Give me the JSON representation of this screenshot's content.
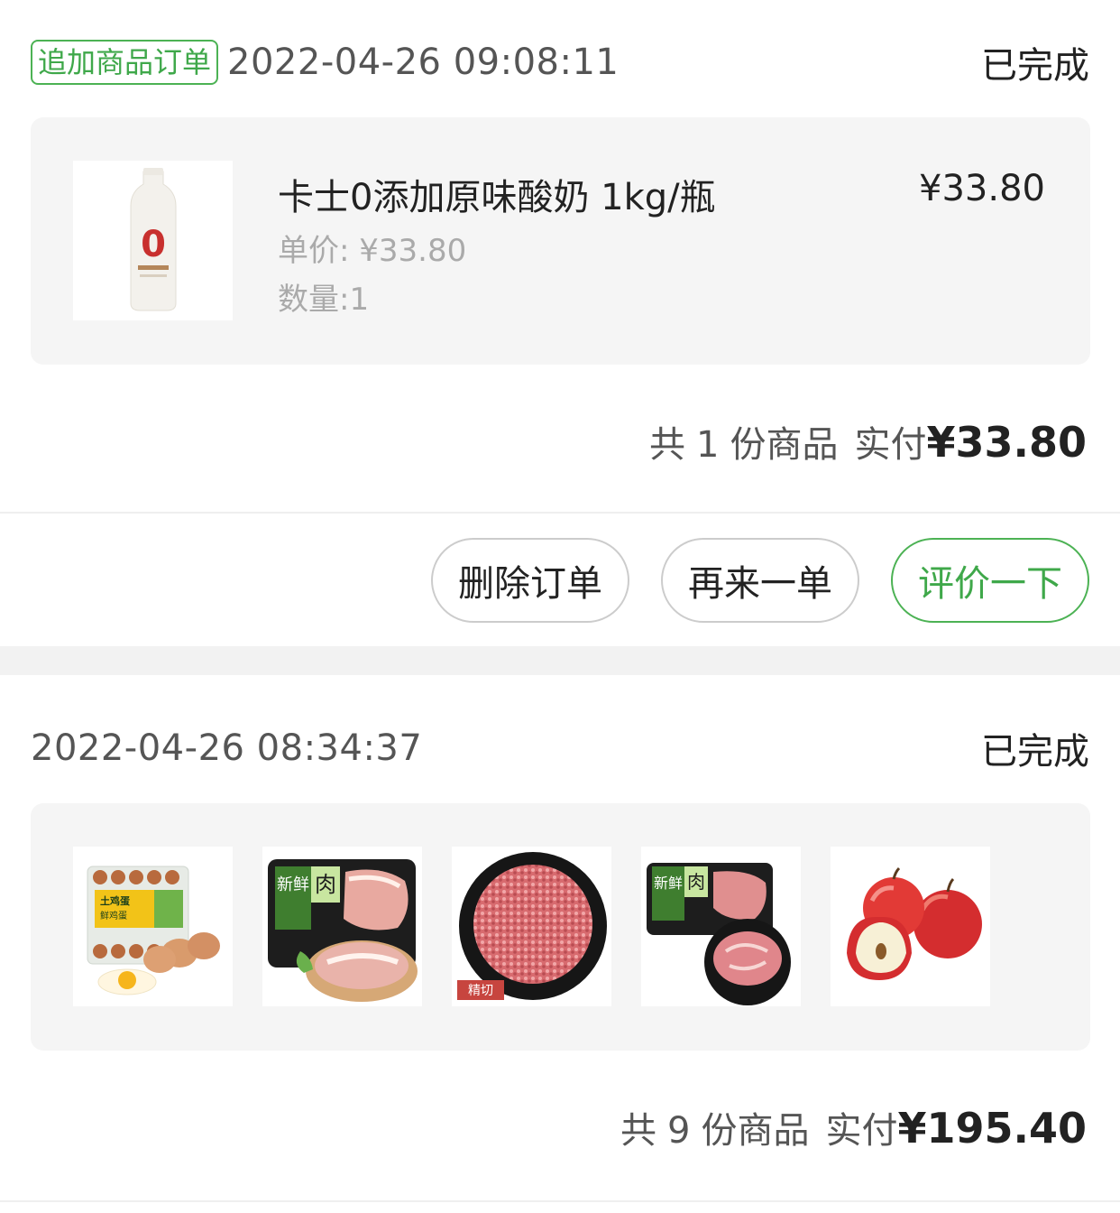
{
  "orders": [
    {
      "tag": "追加商品订单",
      "datetime": "2022-04-26 09:08:11",
      "status": "已完成",
      "product": {
        "name": "卡士0添加原味酸奶 1kg/瓶",
        "price": "¥33.80",
        "unit_price": "单价: ¥33.80",
        "quantity": "数量:1"
      },
      "summary": {
        "prefix": "共",
        "count": "1",
        "suffix": "份商品",
        "paid_label": "实付",
        "amount": "¥33.80"
      },
      "buttons": {
        "delete": "删除订单",
        "reorder": "再来一单",
        "review": "评价一下"
      }
    },
    {
      "datetime": "2022-04-26 08:34:37",
      "status": "已完成",
      "thumbnails": [
        "eggs-image",
        "fresh-pork-belly-image",
        "minced-pork-image",
        "fresh-pork-shoulder-image",
        "red-apples-image"
      ],
      "thumb_labels": {
        "fresh": "新鲜",
        "meat": "肉",
        "fine_cut": "精切"
      },
      "summary": {
        "prefix": "共",
        "count": "9",
        "suffix": "份商品",
        "paid_label": "实付",
        "amount": "¥195.40"
      }
    }
  ],
  "colors": {
    "accent_green": "#4cb254",
    "card_bg": "#f5f5f5",
    "gap_bg": "#f2f2f2"
  }
}
